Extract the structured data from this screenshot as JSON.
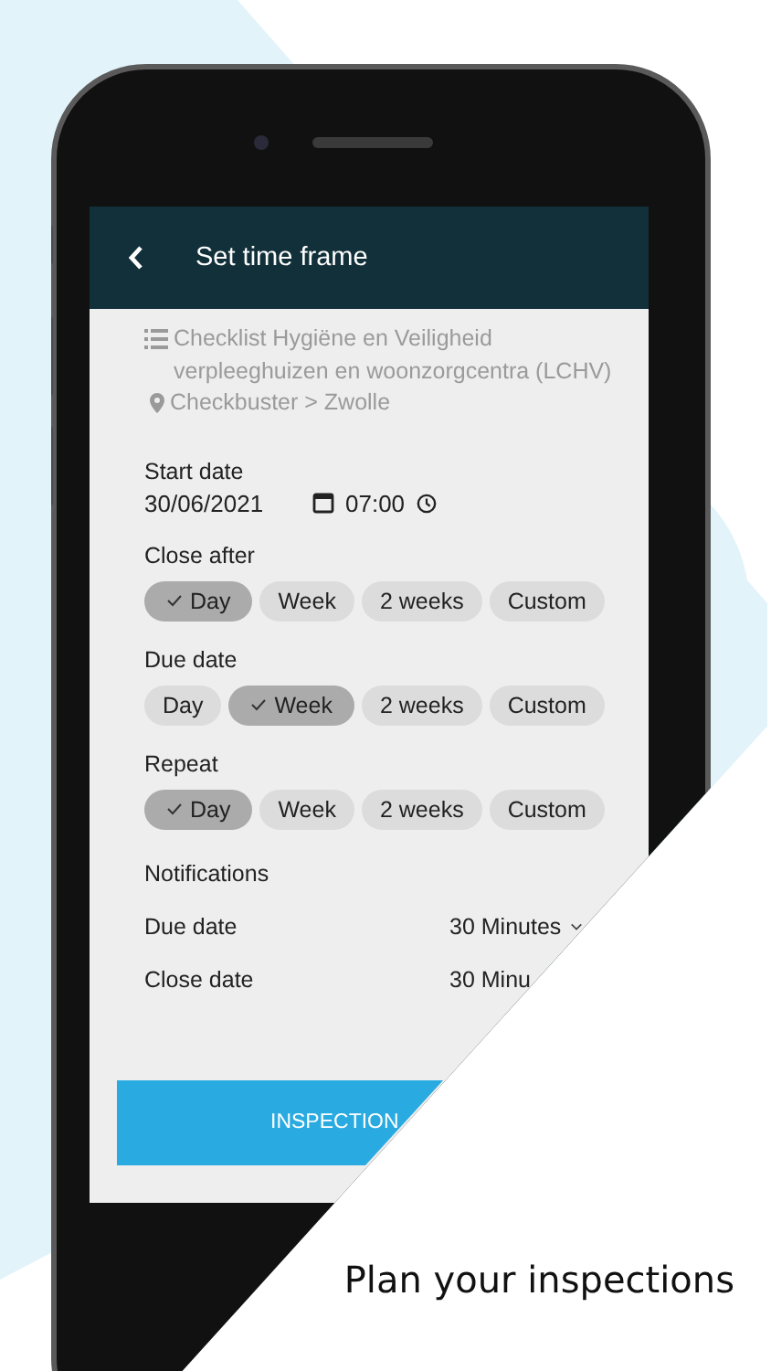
{
  "header": {
    "title": "Set time frame"
  },
  "checklist": {
    "title": "Checklist Hygiëne en Veiligheid verpleeghuizen en woonzorgcentra (LCHV)",
    "location": "Checkbuster > Zwolle"
  },
  "start_date": {
    "label": "Start date",
    "date": "30/06/2021",
    "time": "07:00"
  },
  "choice_groups": [
    {
      "label": "Close after",
      "options": [
        {
          "label": "Day",
          "selected": true
        },
        {
          "label": "Week",
          "selected": false
        },
        {
          "label": "2 weeks",
          "selected": false
        },
        {
          "label": "Custom",
          "selected": false
        }
      ]
    },
    {
      "label": "Due date",
      "options": [
        {
          "label": "Day",
          "selected": false
        },
        {
          "label": "Week",
          "selected": true
        },
        {
          "label": "2 weeks",
          "selected": false
        },
        {
          "label": "Custom",
          "selected": false
        }
      ]
    },
    {
      "label": "Repeat",
      "options": [
        {
          "label": "Day",
          "selected": true
        },
        {
          "label": "Week",
          "selected": false
        },
        {
          "label": "2 weeks",
          "selected": false
        },
        {
          "label": "Custom",
          "selected": false
        }
      ]
    }
  ],
  "notifications": {
    "title": "Notifications",
    "rows": [
      {
        "label": "Due date",
        "value": "30 Minutes",
        "caret": true
      },
      {
        "label": "Close date",
        "value": "30 Minu",
        "caret": false
      }
    ]
  },
  "button": "INSPECTION",
  "tagline": "Plan your inspections"
}
